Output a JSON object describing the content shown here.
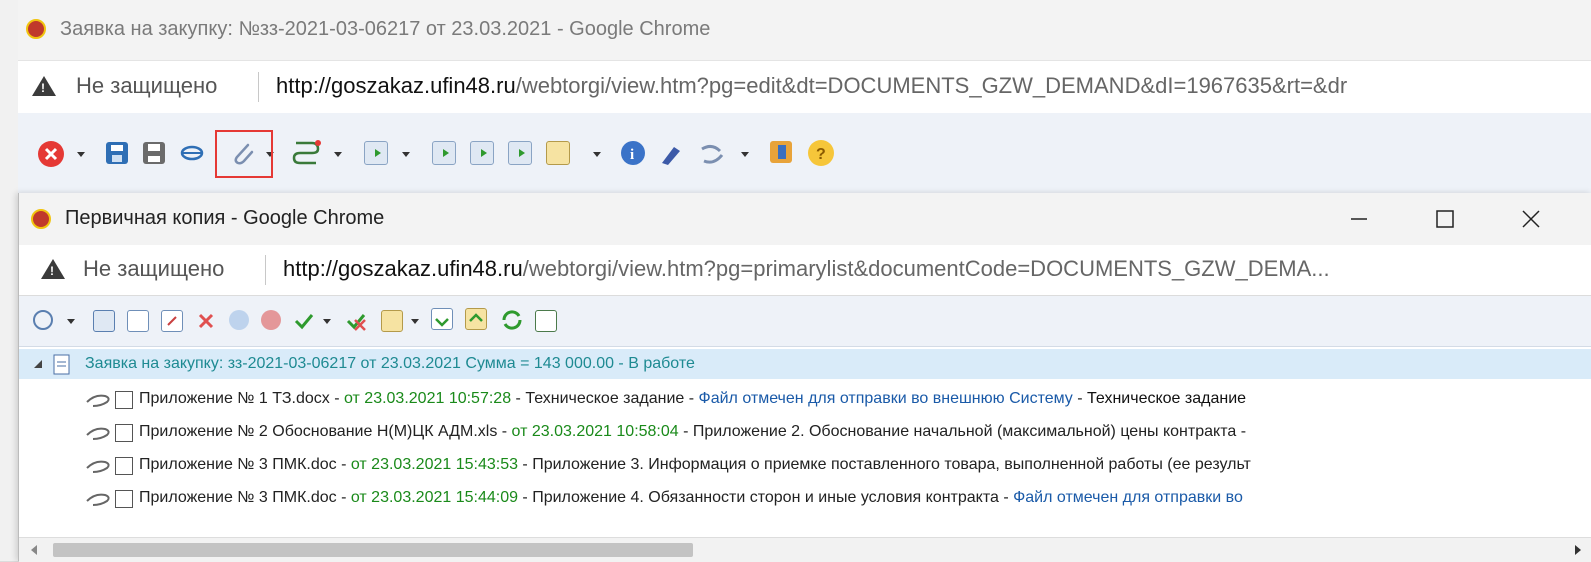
{
  "outer": {
    "title": "Заявка на закупку: №зз-2021-03-06217 от 23.03.2021 - Google Chrome",
    "security": "Не защищено",
    "url_host": "http://goszakaz.ufin48.ru",
    "url_path": "/webtorgi/view.htm?pg=edit&dt=DOCUMENTS_GZW_DEMAND&dI=1967635&rt=&dr"
  },
  "inner": {
    "title": "Первичная копия - Google Chrome",
    "security": "Не защищено",
    "url_host": "http://goszakaz.ufin48.ru",
    "url_path": "/webtorgi/view.htm?pg=primarylist&documentCode=DOCUMENTS_GZW_DEMA...",
    "tree": {
      "root": {
        "main": "Заявка на закупку: зз-2021-03-06217 от 23.03.2021 Сумма = 143 000.00 - ",
        "status": "В работе"
      },
      "items": [
        {
          "name": "Приложение № 1 ТЗ.docx",
          "sep1": " - ",
          "date": "от 23.03.2021 10:57:28",
          "sep2": " - ",
          "desc": "Техническое задание",
          "sep3": " - ",
          "flag": "Файл отмечен для отправки во внешнюю Систему",
          "sep4": " - ",
          "extra": "Техническое задание"
        },
        {
          "name": "Приложение № 2 Обоснование Н(М)ЦК АДМ.xls",
          "sep1": " - ",
          "date": "от 23.03.2021 10:58:04",
          "sep2": " - ",
          "desc": "Приложение 2. Обоснование начальной (максимальной) цены контракта",
          "sep3": " -",
          "flag": "",
          "sep4": "",
          "extra": ""
        },
        {
          "name": "Приложение № 3 ПМК.doc",
          "sep1": " - ",
          "date": "от 23.03.2021 15:43:53",
          "sep2": " - ",
          "desc": "Приложение 3. Информация о приемке поставленного товара, выполненной работы (ее результ",
          "sep3": "",
          "flag": "",
          "sep4": "",
          "extra": ""
        },
        {
          "name": "Приложение № 3 ПМК.doc",
          "sep1": " - ",
          "date": "от 23.03.2021 15:44:09",
          "sep2": " - ",
          "desc": "Приложение 4. Обязанности сторон и иные условия контракта",
          "sep3": " - ",
          "flag": "Файл отмечен для отправки во",
          "sep4": "",
          "extra": ""
        }
      ]
    }
  },
  "colors": {
    "highlight": "#e53935",
    "date_green": "#1a8a1a",
    "link_blue": "#1a5aa8",
    "status_teal": "#1e8a92",
    "tree_header_bg": "#d9ebf9"
  }
}
